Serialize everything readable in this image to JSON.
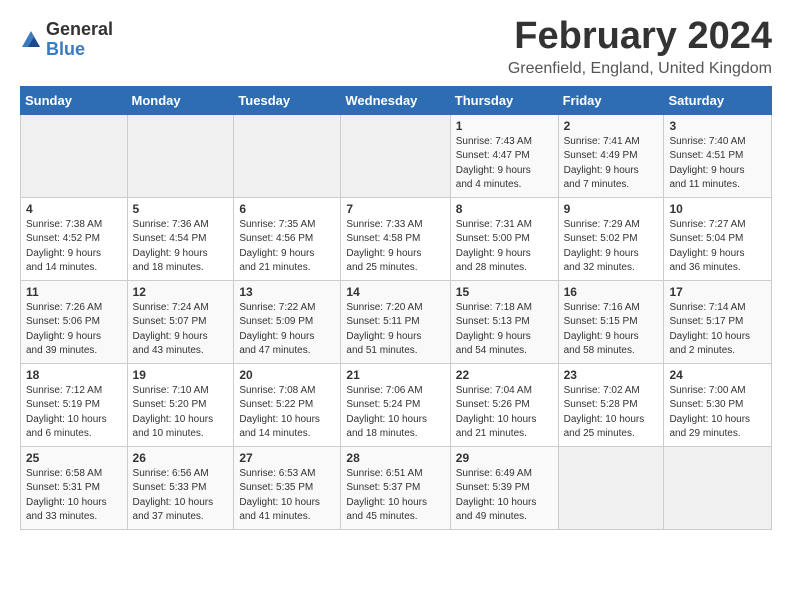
{
  "logo": {
    "general": "General",
    "blue": "Blue"
  },
  "title": "February 2024",
  "location": "Greenfield, England, United Kingdom",
  "headers": [
    "Sunday",
    "Monday",
    "Tuesday",
    "Wednesday",
    "Thursday",
    "Friday",
    "Saturday"
  ],
  "weeks": [
    [
      {
        "day": "",
        "detail": ""
      },
      {
        "day": "",
        "detail": ""
      },
      {
        "day": "",
        "detail": ""
      },
      {
        "day": "",
        "detail": ""
      },
      {
        "day": "1",
        "detail": "Sunrise: 7:43 AM\nSunset: 4:47 PM\nDaylight: 9 hours\nand 4 minutes."
      },
      {
        "day": "2",
        "detail": "Sunrise: 7:41 AM\nSunset: 4:49 PM\nDaylight: 9 hours\nand 7 minutes."
      },
      {
        "day": "3",
        "detail": "Sunrise: 7:40 AM\nSunset: 4:51 PM\nDaylight: 9 hours\nand 11 minutes."
      }
    ],
    [
      {
        "day": "4",
        "detail": "Sunrise: 7:38 AM\nSunset: 4:52 PM\nDaylight: 9 hours\nand 14 minutes."
      },
      {
        "day": "5",
        "detail": "Sunrise: 7:36 AM\nSunset: 4:54 PM\nDaylight: 9 hours\nand 18 minutes."
      },
      {
        "day": "6",
        "detail": "Sunrise: 7:35 AM\nSunset: 4:56 PM\nDaylight: 9 hours\nand 21 minutes."
      },
      {
        "day": "7",
        "detail": "Sunrise: 7:33 AM\nSunset: 4:58 PM\nDaylight: 9 hours\nand 25 minutes."
      },
      {
        "day": "8",
        "detail": "Sunrise: 7:31 AM\nSunset: 5:00 PM\nDaylight: 9 hours\nand 28 minutes."
      },
      {
        "day": "9",
        "detail": "Sunrise: 7:29 AM\nSunset: 5:02 PM\nDaylight: 9 hours\nand 32 minutes."
      },
      {
        "day": "10",
        "detail": "Sunrise: 7:27 AM\nSunset: 5:04 PM\nDaylight: 9 hours\nand 36 minutes."
      }
    ],
    [
      {
        "day": "11",
        "detail": "Sunrise: 7:26 AM\nSunset: 5:06 PM\nDaylight: 9 hours\nand 39 minutes."
      },
      {
        "day": "12",
        "detail": "Sunrise: 7:24 AM\nSunset: 5:07 PM\nDaylight: 9 hours\nand 43 minutes."
      },
      {
        "day": "13",
        "detail": "Sunrise: 7:22 AM\nSunset: 5:09 PM\nDaylight: 9 hours\nand 47 minutes."
      },
      {
        "day": "14",
        "detail": "Sunrise: 7:20 AM\nSunset: 5:11 PM\nDaylight: 9 hours\nand 51 minutes."
      },
      {
        "day": "15",
        "detail": "Sunrise: 7:18 AM\nSunset: 5:13 PM\nDaylight: 9 hours\nand 54 minutes."
      },
      {
        "day": "16",
        "detail": "Sunrise: 7:16 AM\nSunset: 5:15 PM\nDaylight: 9 hours\nand 58 minutes."
      },
      {
        "day": "17",
        "detail": "Sunrise: 7:14 AM\nSunset: 5:17 PM\nDaylight: 10 hours\nand 2 minutes."
      }
    ],
    [
      {
        "day": "18",
        "detail": "Sunrise: 7:12 AM\nSunset: 5:19 PM\nDaylight: 10 hours\nand 6 minutes."
      },
      {
        "day": "19",
        "detail": "Sunrise: 7:10 AM\nSunset: 5:20 PM\nDaylight: 10 hours\nand 10 minutes."
      },
      {
        "day": "20",
        "detail": "Sunrise: 7:08 AM\nSunset: 5:22 PM\nDaylight: 10 hours\nand 14 minutes."
      },
      {
        "day": "21",
        "detail": "Sunrise: 7:06 AM\nSunset: 5:24 PM\nDaylight: 10 hours\nand 18 minutes."
      },
      {
        "day": "22",
        "detail": "Sunrise: 7:04 AM\nSunset: 5:26 PM\nDaylight: 10 hours\nand 21 minutes."
      },
      {
        "day": "23",
        "detail": "Sunrise: 7:02 AM\nSunset: 5:28 PM\nDaylight: 10 hours\nand 25 minutes."
      },
      {
        "day": "24",
        "detail": "Sunrise: 7:00 AM\nSunset: 5:30 PM\nDaylight: 10 hours\nand 29 minutes."
      }
    ],
    [
      {
        "day": "25",
        "detail": "Sunrise: 6:58 AM\nSunset: 5:31 PM\nDaylight: 10 hours\nand 33 minutes."
      },
      {
        "day": "26",
        "detail": "Sunrise: 6:56 AM\nSunset: 5:33 PM\nDaylight: 10 hours\nand 37 minutes."
      },
      {
        "day": "27",
        "detail": "Sunrise: 6:53 AM\nSunset: 5:35 PM\nDaylight: 10 hours\nand 41 minutes."
      },
      {
        "day": "28",
        "detail": "Sunrise: 6:51 AM\nSunset: 5:37 PM\nDaylight: 10 hours\nand 45 minutes."
      },
      {
        "day": "29",
        "detail": "Sunrise: 6:49 AM\nSunset: 5:39 PM\nDaylight: 10 hours\nand 49 minutes."
      },
      {
        "day": "",
        "detail": ""
      },
      {
        "day": "",
        "detail": ""
      }
    ]
  ]
}
